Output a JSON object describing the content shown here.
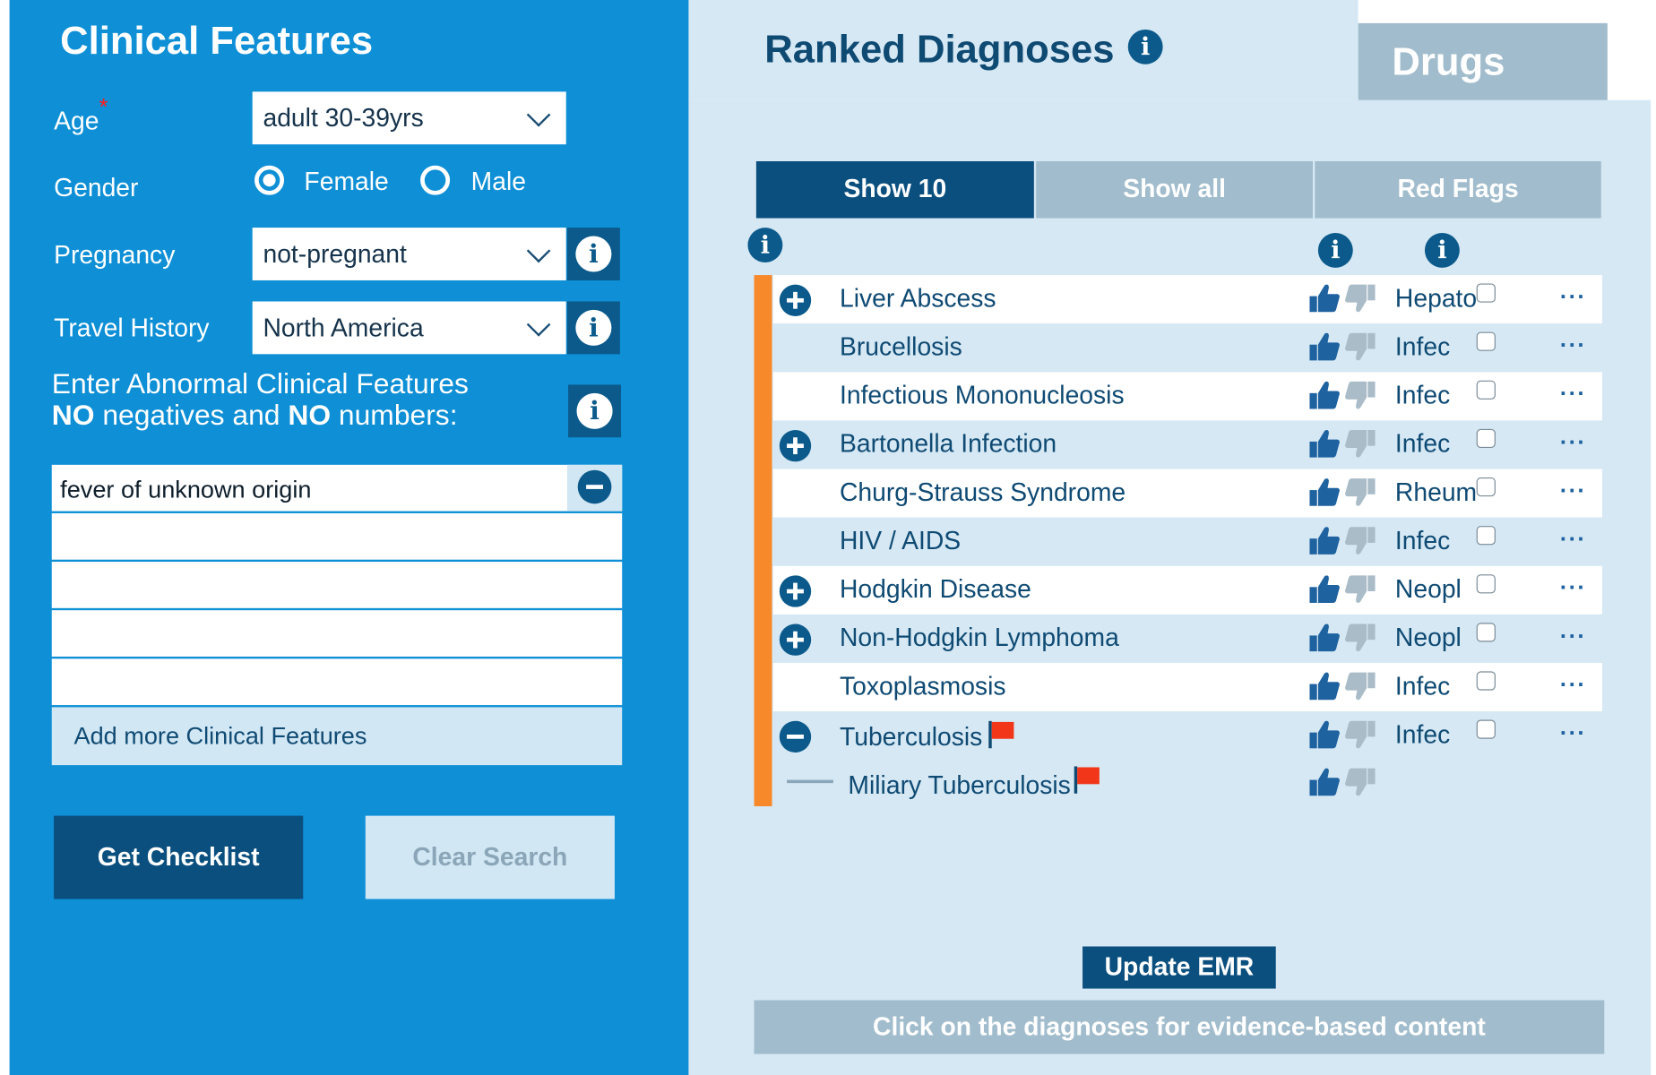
{
  "left": {
    "title": "Clinical Features",
    "age": {
      "label": "Age",
      "required": "*",
      "value": "adult 30-39yrs"
    },
    "gender": {
      "label": "Gender",
      "options": [
        "Female",
        "Male"
      ],
      "selected": "Female"
    },
    "pregnancy": {
      "label": "Pregnancy",
      "value": "not-pregnant"
    },
    "travel": {
      "label": "Travel History",
      "value": "North America"
    },
    "instructions": {
      "line1": "Enter Abnormal Clinical Features",
      "line2_a": "NO",
      "line2_b": " negatives and ",
      "line2_c": "NO",
      "line2_d": " numbers:"
    },
    "features": [
      "fever of unknown origin",
      "",
      "",
      "",
      ""
    ],
    "add_more": "Add more Clinical Features",
    "get_checklist": "Get Checklist",
    "clear_search": "Clear Search"
  },
  "right": {
    "title": "Ranked Diagnoses",
    "drugs_tab": "Drugs",
    "tabs": [
      "Show 10",
      "Show all",
      "Red Flags"
    ],
    "active_tab": "Show 10",
    "diagnoses": [
      {
        "name": "Liver Abscess",
        "category": "Hepato",
        "expander": "plus",
        "red_flag": false
      },
      {
        "name": "Brucellosis",
        "category": "Infec",
        "expander": "none",
        "red_flag": false
      },
      {
        "name": "Infectious Mononucleosis",
        "category": "Infec",
        "expander": "none",
        "red_flag": false
      },
      {
        "name": "Bartonella Infection",
        "category": "Infec",
        "expander": "plus",
        "red_flag": false
      },
      {
        "name": "Churg-Strauss Syndrome",
        "category": "Rheum",
        "expander": "none",
        "red_flag": false
      },
      {
        "name": "HIV / AIDS",
        "category": "Infec",
        "expander": "none",
        "red_flag": false
      },
      {
        "name": "Hodgkin Disease",
        "category": "Neopl",
        "expander": "plus",
        "red_flag": false
      },
      {
        "name": "Non-Hodgkin Lymphoma",
        "category": "Neopl",
        "expander": "plus",
        "red_flag": false
      },
      {
        "name": "Toxoplasmosis",
        "category": "Infec",
        "expander": "none",
        "red_flag": false
      },
      {
        "name": "Tuberculosis",
        "category": "Infec",
        "expander": "minus",
        "red_flag": true
      }
    ],
    "sub_diagnosis": {
      "name": "Miliary Tuberculosis",
      "red_flag": true
    },
    "more_symbol": "···",
    "update_emr": "Update EMR",
    "footer_note": "Click on the diagnoses for evidence-based content"
  },
  "colors": {
    "left_panel": "#0e8fd6",
    "right_panel": "#d5e8f4",
    "dark_blue": "#0b5a8b",
    "orange_bar": "#f7892b",
    "red_flag": "#f2361a"
  },
  "icons": [
    "info-icon",
    "chevron-down-icon",
    "thumbs-up-icon",
    "thumbs-down-icon",
    "plus-circle-icon",
    "minus-circle-icon",
    "flag-icon",
    "more-icon"
  ]
}
